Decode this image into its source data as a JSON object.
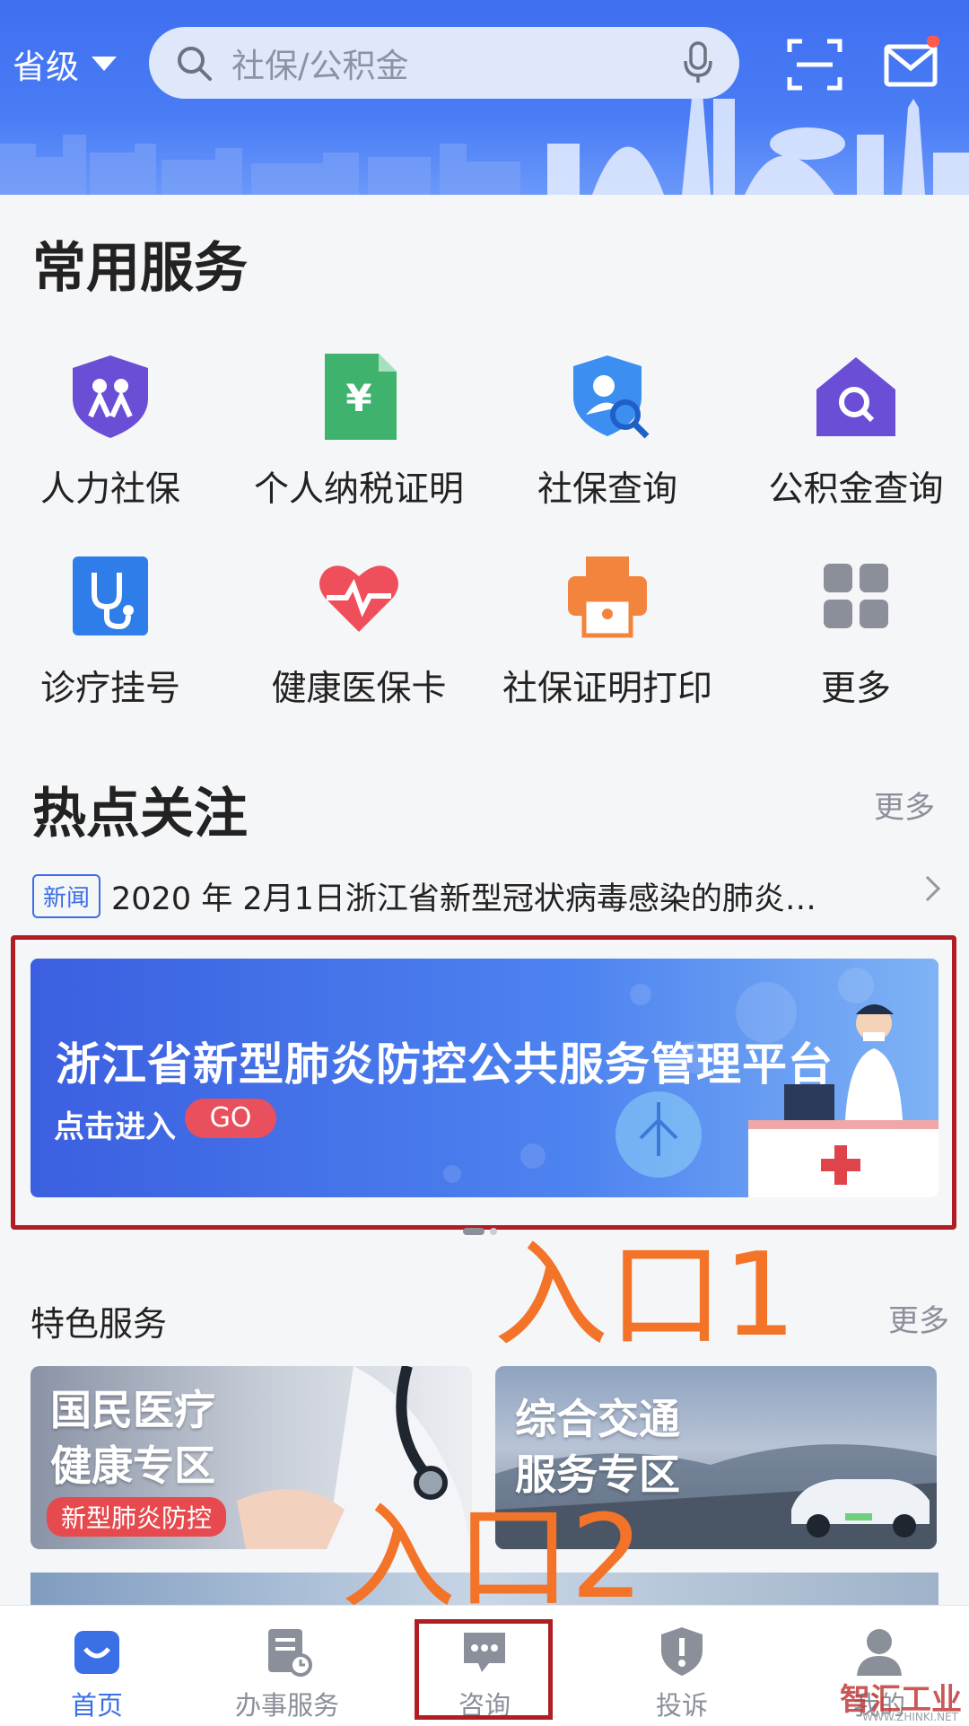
{
  "header": {
    "province": "省级",
    "search_placeholder": "社保/公积金",
    "icons": [
      "search-icon",
      "mic-icon",
      "scan-icon",
      "mail-icon"
    ]
  },
  "common_services": {
    "title": "常用服务",
    "items": [
      {
        "label": "人力社保",
        "icon": "social-security-shield-icon"
      },
      {
        "label": "个人纳税证明",
        "icon": "tax-document-icon"
      },
      {
        "label": "社保查询",
        "icon": "user-search-icon"
      },
      {
        "label": "公积金查询",
        "icon": "house-search-icon"
      },
      {
        "label": "诊疗挂号",
        "icon": "stethoscope-icon"
      },
      {
        "label": "健康医保卡",
        "icon": "heart-pulse-icon"
      },
      {
        "label": "社保证明打印",
        "icon": "printer-icon"
      },
      {
        "label": "更多",
        "icon": "grid-icon"
      }
    ]
  },
  "hot_topics": {
    "title": "热点关注",
    "more": "更多",
    "news_badge": "新闻",
    "news_text": "2020 年 2月1日浙江省新型冠状病毒感染的肺炎…"
  },
  "banner": {
    "title": "浙江省新型肺炎防控公共服务管理平台",
    "subtitle": "点击进入",
    "go": "GO"
  },
  "annotations": {
    "entry1": "入口1",
    "entry2": "入口2"
  },
  "featured_services": {
    "title": "特色服务",
    "more": "更多",
    "cards": [
      {
        "line1": "国民医疗",
        "line2": "健康专区",
        "tag": "新型肺炎防控"
      },
      {
        "line1": "综合交通",
        "line2": "服务专区",
        "tag": ""
      }
    ]
  },
  "bottom_nav": {
    "items": [
      {
        "label": "首页",
        "icon": "home-icon",
        "active": true
      },
      {
        "label": "办事服务",
        "icon": "service-doc-icon",
        "active": false
      },
      {
        "label": "咨询",
        "icon": "chat-icon",
        "active": false
      },
      {
        "label": "投诉",
        "icon": "complaint-shield-icon",
        "active": false
      },
      {
        "label": "我的",
        "icon": "profile-icon",
        "active": false
      }
    ]
  },
  "watermark": {
    "text": "智汇工业",
    "sub": "WWW.ZHINKI.NET"
  },
  "colors": {
    "primary": "#3b6fe6",
    "annotation": "#f37328",
    "highlight_box": "#b01e23"
  }
}
